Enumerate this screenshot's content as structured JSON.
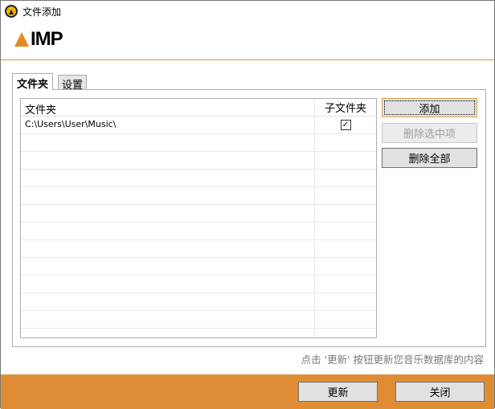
{
  "window": {
    "title": "文件添加",
    "logo": "AIMP"
  },
  "tabs": [
    {
      "label": "文件夹",
      "active": true
    },
    {
      "label": "设置",
      "active": false
    }
  ],
  "list": {
    "columns": [
      "文件夹",
      "子文件夹"
    ],
    "rows": [
      {
        "folder": "C:\\Users\\User\\Music\\",
        "subfolders": true
      }
    ]
  },
  "buttons": {
    "add": "添加",
    "delete_selected": "删除选中项",
    "delete_all": "删除全部",
    "update": "更新",
    "close": "关闭"
  },
  "hint": "点击 '更新' 按钮更新您音乐数据库的内容",
  "check_glyph": "✓"
}
